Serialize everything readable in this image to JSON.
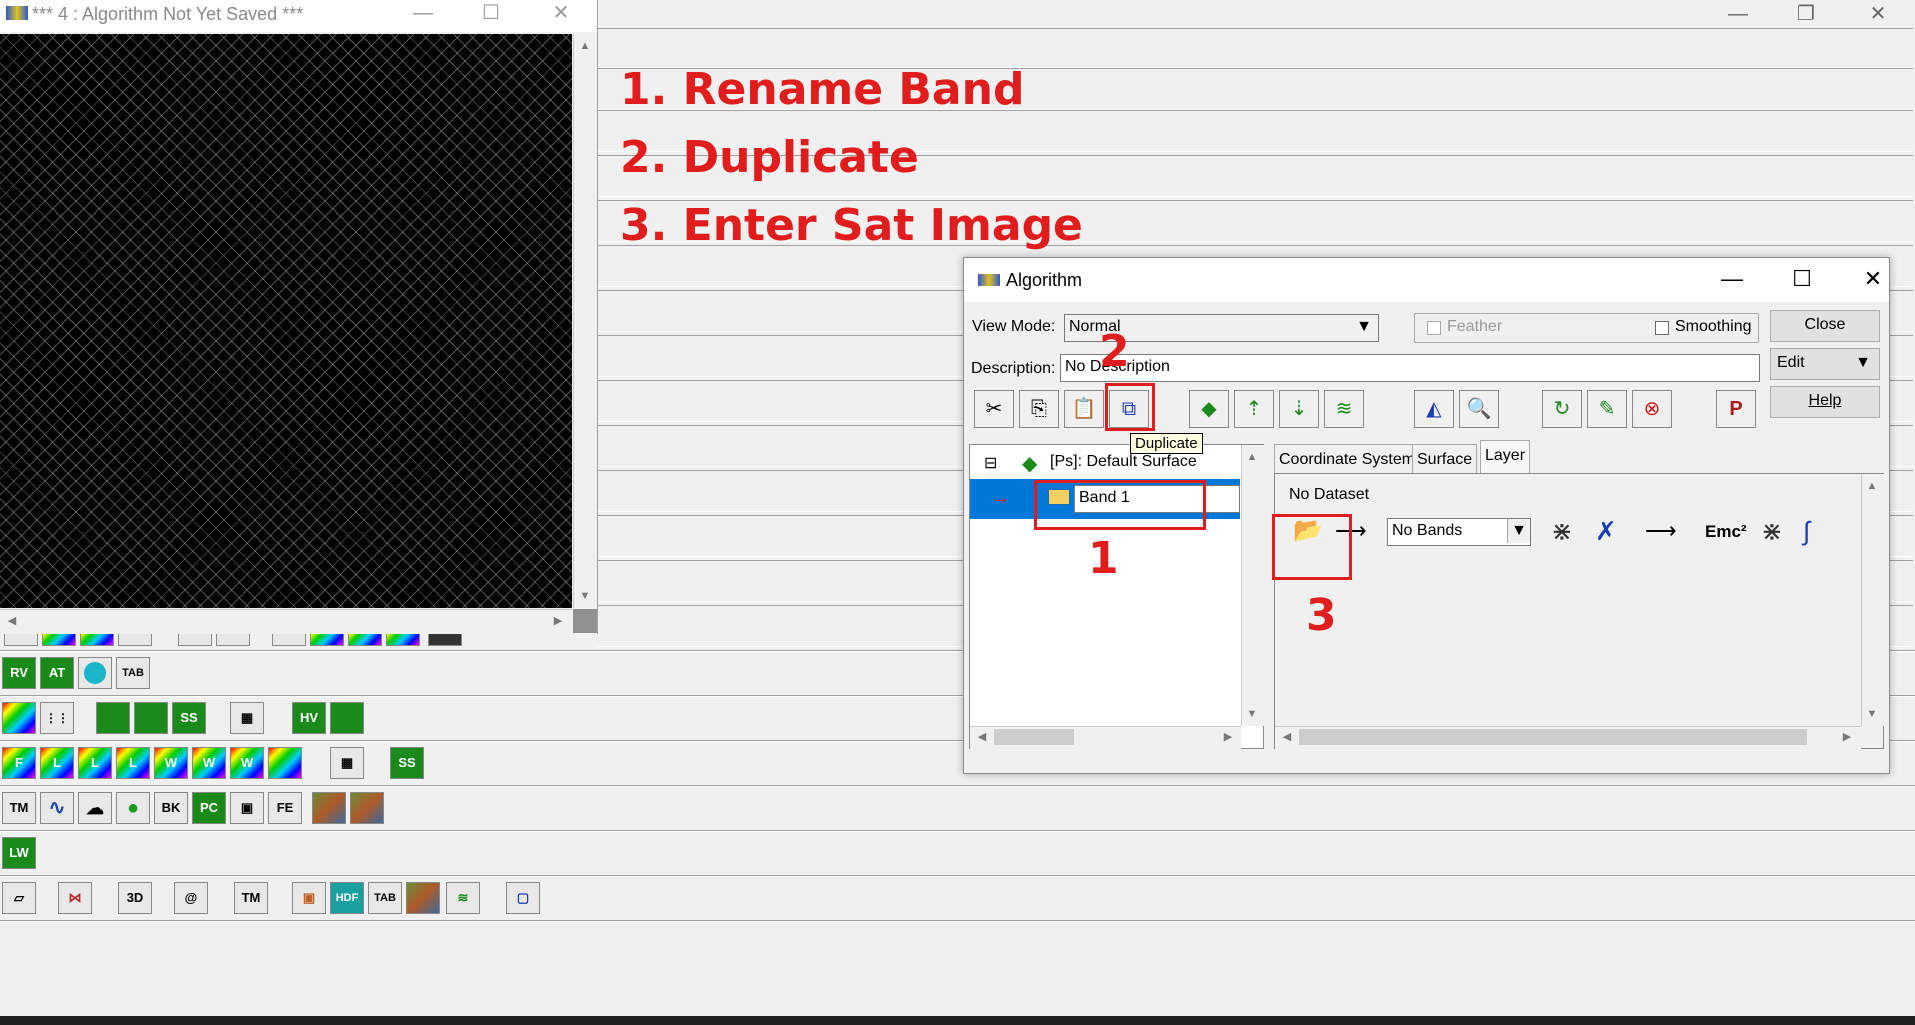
{
  "viewer_window": {
    "title": "*** 4 : Algorithm Not Yet Saved ***",
    "minimize_glyph": "—",
    "maximize_glyph": "☐",
    "close_glyph": "✕"
  },
  "main_window": {
    "minimize_glyph": "—",
    "restore_glyph": "❐",
    "close_glyph": "✕"
  },
  "annotations": {
    "step1": "1. Rename Band",
    "step2": "2. Duplicate",
    "step3": "3. Enter Sat Image",
    "marker1": "1",
    "marker2": "2",
    "marker3": "3"
  },
  "toolbar_rows": {
    "row_a": [
      "RV",
      "AT",
      "",
      "TAB"
    ],
    "row_b": [
      "",
      "",
      "",
      "",
      "SS",
      "",
      "HV",
      ""
    ],
    "row_c": [
      "F",
      "L",
      "L",
      "L",
      "W",
      "W",
      "W",
      "",
      "",
      "SS"
    ],
    "row_d": [
      "TM",
      "",
      "",
      "",
      "BK",
      "PC",
      "",
      "FE",
      "",
      ""
    ],
    "row_e": [
      "LW"
    ],
    "row_f": [
      "",
      "",
      "3D",
      "",
      "TM",
      "",
      "HDF",
      "TAB",
      "",
      "",
      ""
    ]
  },
  "algorithm_dialog": {
    "title": "Algorithm",
    "minimize_glyph": "—",
    "maximize_glyph": "☐",
    "close_glyph": "✕",
    "view_mode_label": "View Mode:",
    "view_mode_value": "Normal",
    "feather_label": "Feather",
    "smoothing_label": "Smoothing",
    "close_button": "Close",
    "description_label": "Description:",
    "description_value": "No Description",
    "edit_button": "Edit",
    "help_button": "Help",
    "tooltip": "Duplicate",
    "tree": {
      "root_label": "[Ps]: Default Surface",
      "band_label": "Band 1"
    },
    "tabs": [
      "Coordinate System",
      "Surface",
      "Layer"
    ],
    "layer_panel": {
      "dataset_label": "No Dataset",
      "bands_select": "No Bands",
      "formula_label": "Emc²"
    }
  }
}
